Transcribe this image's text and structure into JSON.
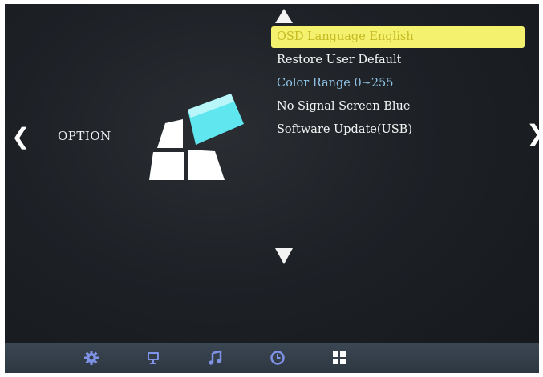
{
  "section": {
    "title": "OPTION"
  },
  "menu": {
    "items": [
      {
        "label": "OSD Language English",
        "state": "selected"
      },
      {
        "label": "Restore User Default",
        "state": "normal"
      },
      {
        "label": "Color Range 0~255",
        "state": "disabled"
      },
      {
        "label": "No Signal Screen Blue",
        "state": "normal"
      },
      {
        "label": "Software Update(USB)",
        "state": "normal"
      }
    ]
  },
  "nav": {
    "left_glyph": "❮",
    "right_glyph": "❯"
  },
  "bottom_bar": {
    "icons": [
      "gear-icon",
      "monitor-icon",
      "music-note-icon",
      "clock-icon",
      "windows-grid-icon"
    ],
    "icon_color": "#7e92e6"
  },
  "colors": {
    "background": "#1d2126",
    "highlight": "#f4f16e",
    "highlight_text": "#c6ba22",
    "disabled_text": "#8fc3e6",
    "icon_cyan": "#5fe6ee"
  }
}
